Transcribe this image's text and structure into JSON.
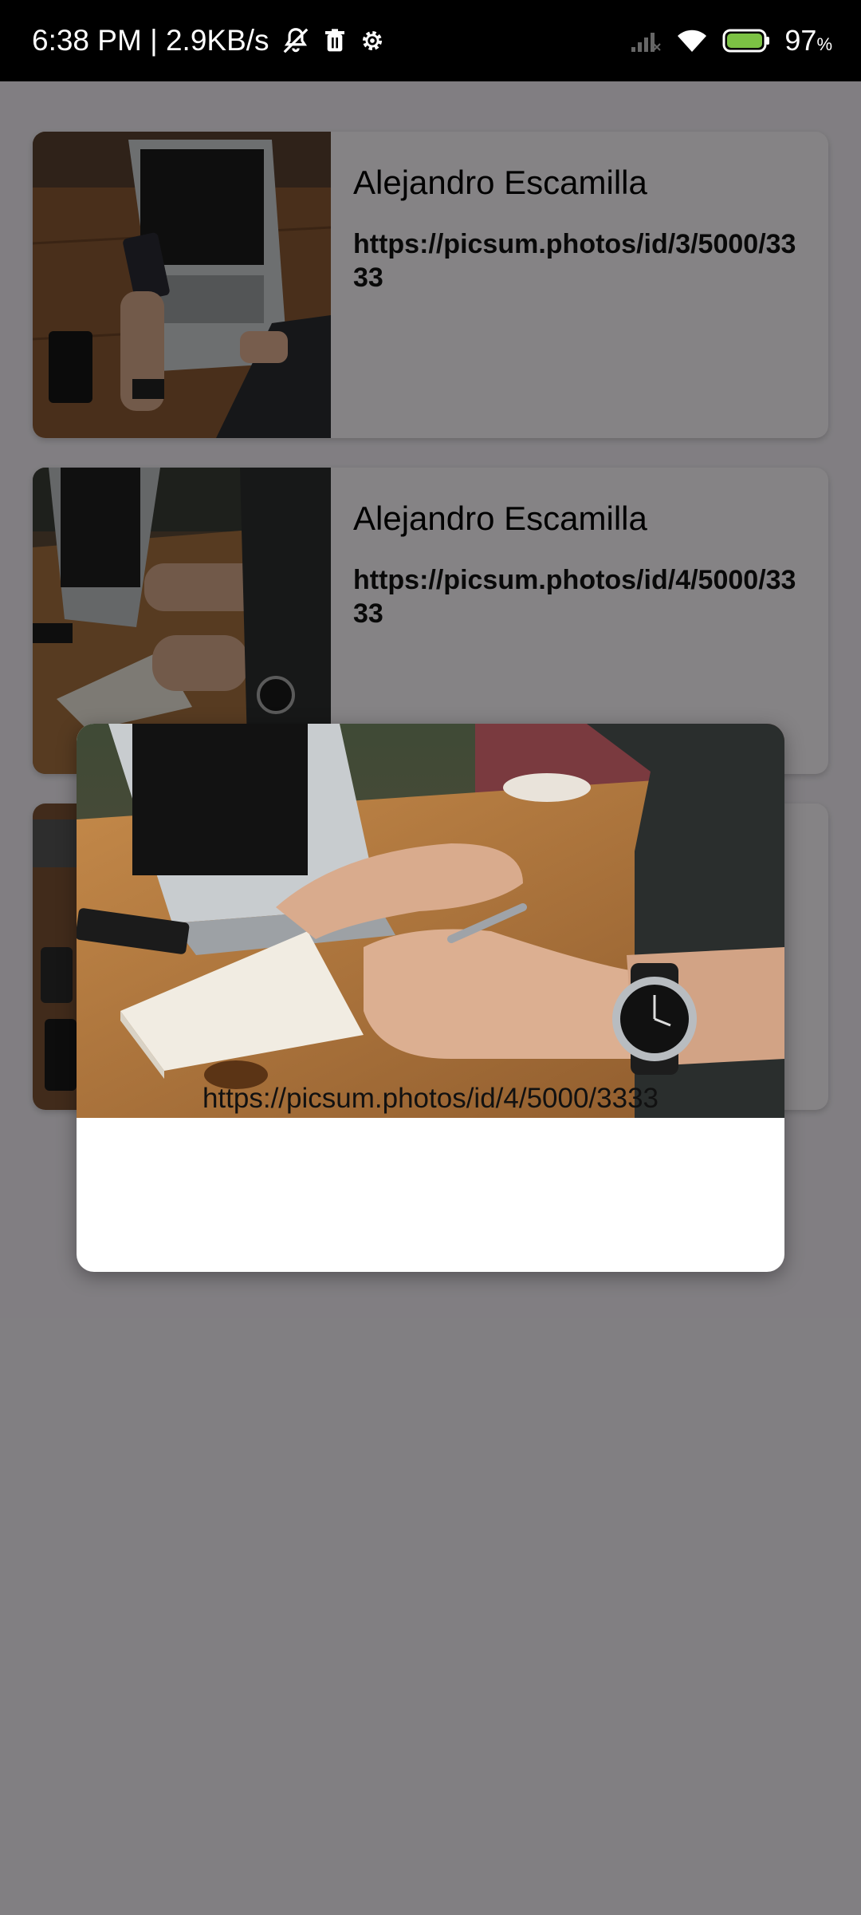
{
  "status_bar": {
    "time_speed": "6:38 PM | 2.9KB/s",
    "battery_percent": "97",
    "battery_symbol": "%",
    "icons": [
      "bell-muted-icon",
      "trash-icon",
      "gear-icon",
      "signal-icon",
      "wifi-icon",
      "battery-icon"
    ],
    "battery_color": "#7cc244"
  },
  "list": {
    "items": [
      {
        "author": "Alejandro Escamilla",
        "url": "https://picsum.photos/id/3/5000/3333"
      },
      {
        "author": "Alejandro Escamilla",
        "url": "https://picsum.photos/id/4/5000/3333"
      },
      {
        "author": "",
        "url": ""
      }
    ]
  },
  "dialog": {
    "url": "https://picsum.photos/id/4/5000/3333"
  },
  "colors": {
    "scrim": "#000000",
    "card_bg": "#fbf7fb",
    "page_bg": "#f3eff5"
  }
}
